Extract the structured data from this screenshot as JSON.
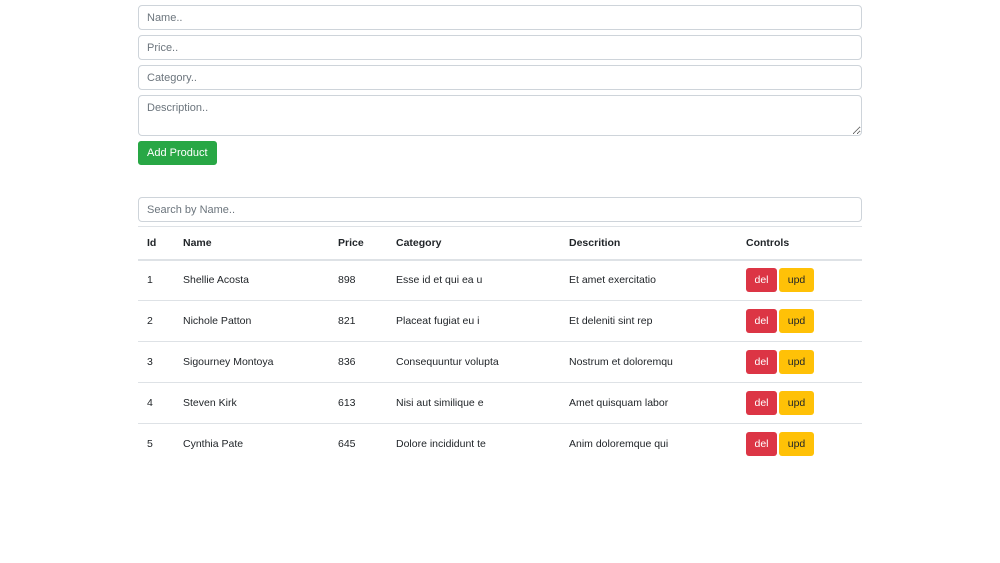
{
  "form": {
    "name_placeholder": "Name..",
    "price_placeholder": "Price..",
    "category_placeholder": "Category..",
    "description_placeholder": "Description..",
    "add_button_label": "Add Product"
  },
  "search": {
    "placeholder": "Search by Name.."
  },
  "table": {
    "headers": [
      "Id",
      "Name",
      "Price",
      "Category",
      "Descrition",
      "Controls"
    ],
    "rows": [
      {
        "id": "1",
        "name": "Shellie Acosta",
        "price": "898",
        "category": "Esse id et qui ea u",
        "description": "Et amet exercitatio",
        "del": "del",
        "upd": "upd"
      },
      {
        "id": "2",
        "name": "Nichole Patton",
        "price": "821",
        "category": "Placeat fugiat eu i",
        "description": "Et deleniti sint rep",
        "del": "del",
        "upd": "upd"
      },
      {
        "id": "3",
        "name": "Sigourney Montoya",
        "price": "836",
        "category": "Consequuntur volupta",
        "description": "Nostrum et doloremqu",
        "del": "del",
        "upd": "upd"
      },
      {
        "id": "4",
        "name": "Steven Kirk",
        "price": "613",
        "category": "Nisi aut similique e",
        "description": "Amet quisquam labor",
        "del": "del",
        "upd": "upd"
      },
      {
        "id": "5",
        "name": "Cynthia Pate",
        "price": "645",
        "category": "Dolore incididunt te",
        "description": "Anim doloremque qui",
        "del": "del",
        "upd": "upd"
      }
    ]
  },
  "colors": {
    "add_button": "#28a745",
    "delete_button": "#dc3545",
    "update_button": "#ffc107"
  }
}
